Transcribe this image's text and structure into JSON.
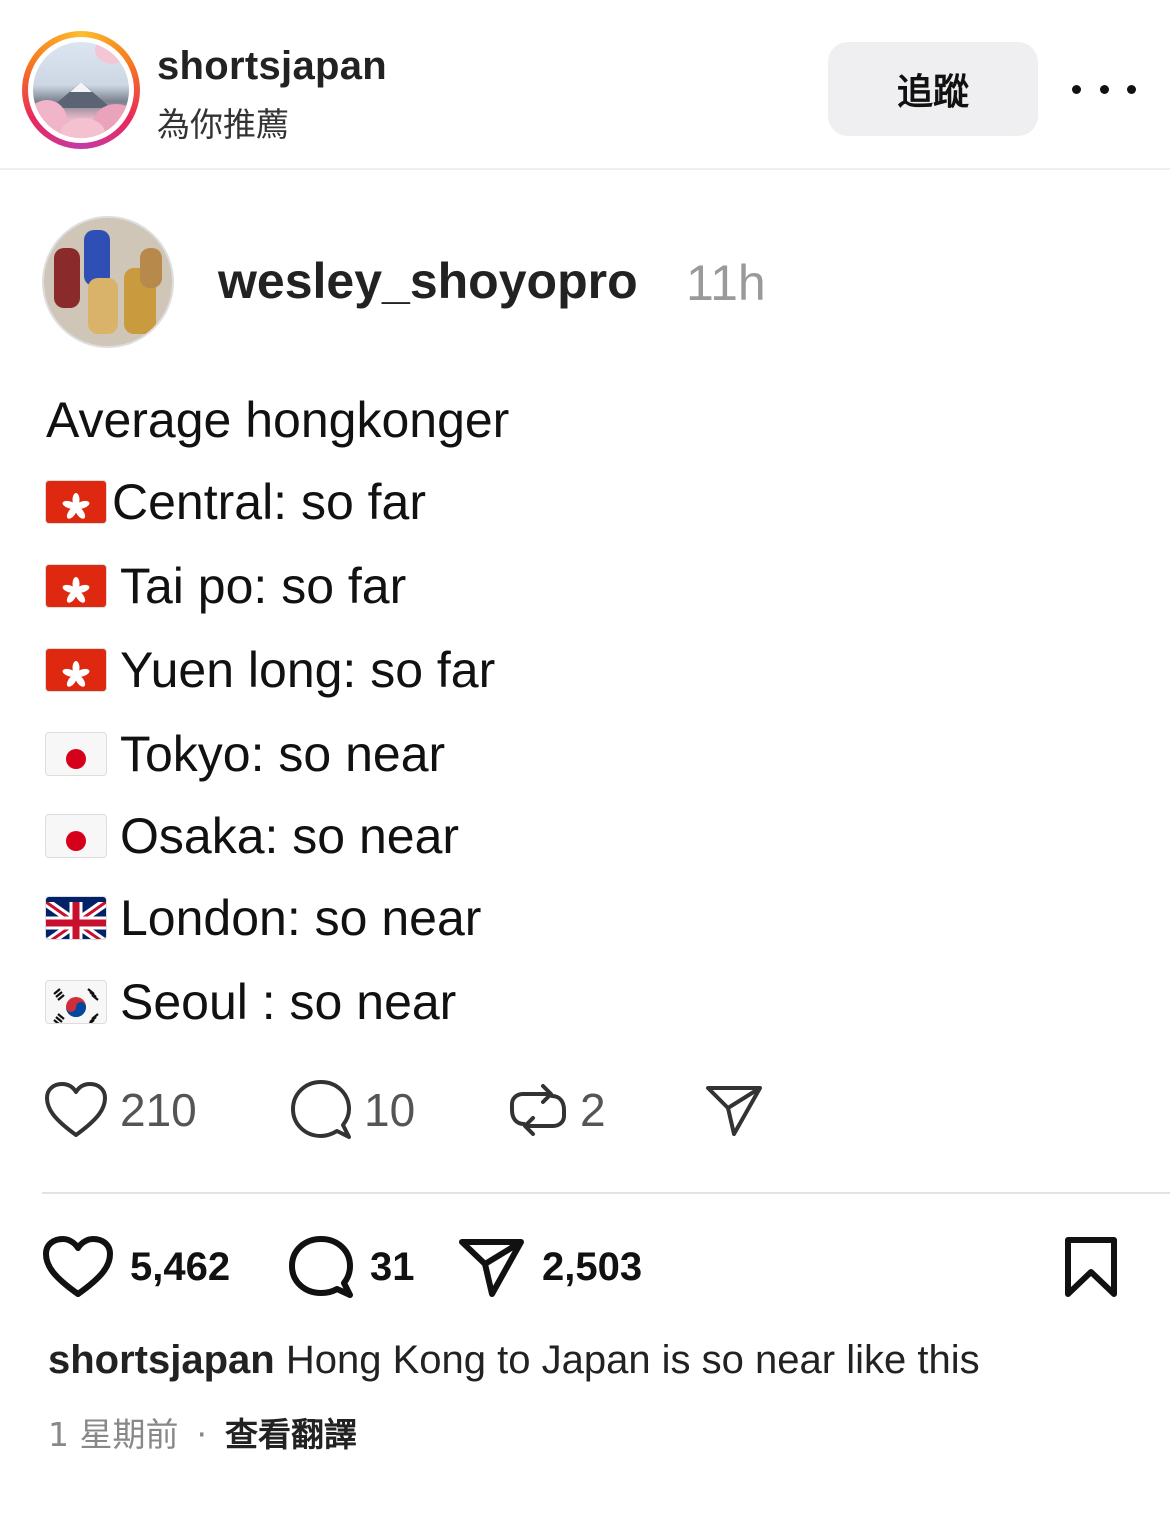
{
  "header": {
    "account_name": "shortsjapan",
    "subtitle": "為你推薦",
    "follow_label": "追蹤"
  },
  "embedded_post": {
    "username": "wesley_shoyopro",
    "time": "11h",
    "title": "Average hongkonger",
    "lines": [
      {
        "flag": "hong-kong-flag-icon",
        "text": "Central: so far"
      },
      {
        "flag": "hong-kong-flag-icon",
        "text": "Tai po: so far"
      },
      {
        "flag": "hong-kong-flag-icon",
        "text": "Yuen long: so far"
      },
      {
        "flag": "japan-flag-icon",
        "text": "Tokyo: so near"
      },
      {
        "flag": "japan-flag-icon",
        "text": "Osaka: so near"
      },
      {
        "flag": "uk-flag-icon",
        "text": "London: so near"
      },
      {
        "flag": "south-korea-flag-icon",
        "text": "Seoul : so near"
      }
    ],
    "stats": {
      "likes": "210",
      "replies": "10",
      "reposts": "2"
    }
  },
  "actions": {
    "likes": "5,462",
    "comments": "31",
    "shares": "2,503"
  },
  "caption": {
    "author": "shortsjapan",
    "text": " Hong Kong to Japan is so near like this"
  },
  "meta": {
    "age": "1 星期前",
    "separator": "·",
    "translate_label": "查看翻譯"
  },
  "colors": {
    "story_ring": [
      "#fbbe2f",
      "#e8295b",
      "#c53aa8"
    ],
    "follow_bg": "#efeff1",
    "muted": "#9a9a9a"
  }
}
